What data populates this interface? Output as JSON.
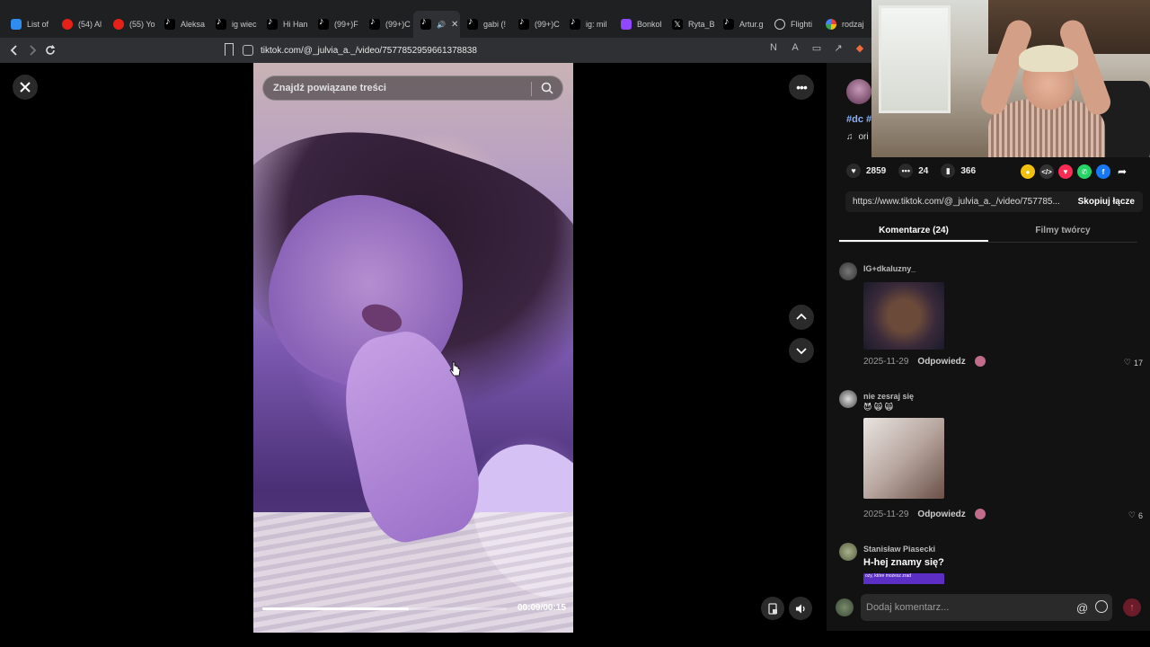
{
  "browser": {
    "tabs": [
      {
        "label": "List of",
        "icon": "sheet"
      },
      {
        "label": "(54) Al",
        "icon": "youtube"
      },
      {
        "label": "(55) Yo",
        "icon": "youtube"
      },
      {
        "label": "Aleksa",
        "icon": "tiktok"
      },
      {
        "label": "ig wiec",
        "icon": "tiktok"
      },
      {
        "label": "Hi Han",
        "icon": "tiktok"
      },
      {
        "label": "(99+)F",
        "icon": "tiktok"
      },
      {
        "label": "(99+)C",
        "icon": "tiktok"
      },
      {
        "label": "",
        "icon": "tiktok",
        "active": true
      },
      {
        "label": "gabi (!",
        "icon": "tiktok"
      },
      {
        "label": "(99+)C",
        "icon": "tiktok"
      },
      {
        "label": "ig: mil",
        "icon": "tiktok"
      },
      {
        "label": "Bonkol",
        "icon": "twitch"
      },
      {
        "label": "Ryta_B",
        "icon": "x"
      },
      {
        "label": "Artur.g",
        "icon": "tiktok"
      },
      {
        "label": "Flighti",
        "icon": "globe"
      },
      {
        "label": "rodzaj",
        "icon": "google"
      }
    ],
    "url": "tiktok.com/@_julvia_a._/video/7577852959661378838"
  },
  "player": {
    "search_placeholder": "Znajdź powiązane treści",
    "time": "00:09/00:15",
    "progress_fraction": 0.6
  },
  "panel": {
    "hashtags": "#dc #",
    "music": "ori",
    "likes": "2859",
    "comments_count": "24",
    "saves": "366",
    "link": "https://www.tiktok.com/@_julvia_a._/video/757785...",
    "copy_label": "Skopiuj łącze",
    "tab_comments": "Komentarze (24)",
    "tab_creator": "Filmy twórcy",
    "comments": [
      {
        "user": "IG+dkaluzny_",
        "text": "",
        "date": "2025-11-29",
        "reply": "Odpowiedz",
        "likes": "17",
        "has_image": true
      },
      {
        "user": "nie zesraj się",
        "text": "😈 🙀 🙀",
        "date": "2025-11-29",
        "reply": "Odpowiedz",
        "likes": "6",
        "has_image": true
      },
      {
        "user": "Stanisław Piasecki",
        "text": "H-hej znamy się?",
        "image_caption": "ozy, które możesz zrad"
      }
    ],
    "composer_placeholder": "Dodaj komentarz...",
    "composer_at": "@"
  },
  "colors": {
    "panel_bg": "#121212",
    "link_accent": "#8ab4ff",
    "send_accent": "#6a1c28"
  }
}
